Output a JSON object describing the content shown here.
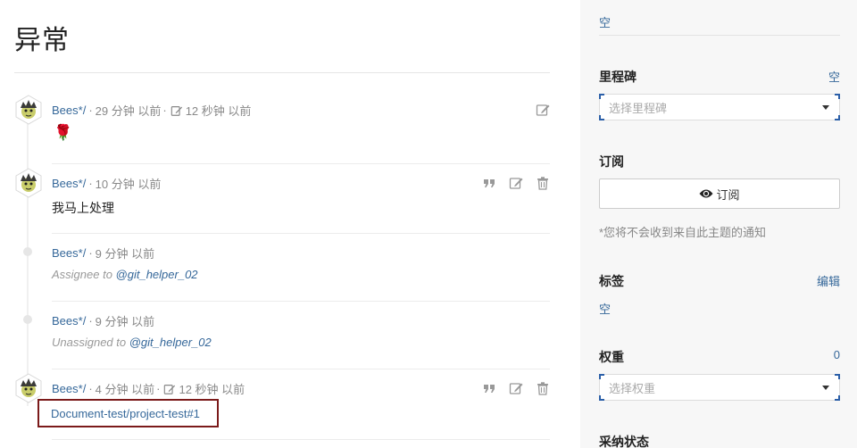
{
  "page": {
    "title": "异常"
  },
  "timeline": [
    {
      "kind": "comment",
      "author": "Bees*/",
      "time": "29 分钟 以前",
      "edited": "12 秒钟 以前",
      "body": "🌹"
    },
    {
      "kind": "comment",
      "author": "Bees*/",
      "time": "10 分钟 以前",
      "body": "我马上处理"
    },
    {
      "kind": "event",
      "author": "Bees*/",
      "time": "9 分钟 以前",
      "action_text": "Assignee to ",
      "mention": "@git_helper_02"
    },
    {
      "kind": "event",
      "author": "Bees*/",
      "time": "9 分钟 以前",
      "action_text": "Unassigned to ",
      "mention": "@git_helper_02"
    },
    {
      "kind": "comment",
      "author": "Bees*/",
      "time": "4 分钟 以前",
      "edited": "12 秒钟 以前",
      "body": "Document-test/project-test#1"
    }
  ],
  "sidebar": {
    "top_value": "空",
    "milestone": {
      "label": "里程碑",
      "value": "空",
      "placeholder": "选择里程碑"
    },
    "subscribe": {
      "label": "订阅",
      "button": "订阅",
      "note": "*您将不会收到来自此主题的通知"
    },
    "tags": {
      "label": "标签",
      "edit": "编辑",
      "value": "空"
    },
    "weight": {
      "label": "权重",
      "value": "0",
      "placeholder": "选择权重"
    },
    "adopt": {
      "label": "采纳状态"
    }
  },
  "meta_sep": "·",
  "icons": {
    "edit": "pencil-square-icon",
    "quote": "quote-icon",
    "delete": "trash-icon",
    "eye": "eye-icon",
    "avatar": "hedgehog-avatar"
  },
  "colors": {
    "link": "#36689a",
    "highlight_border": "#7b1a1a",
    "select_corner": "#2b5fa8"
  }
}
